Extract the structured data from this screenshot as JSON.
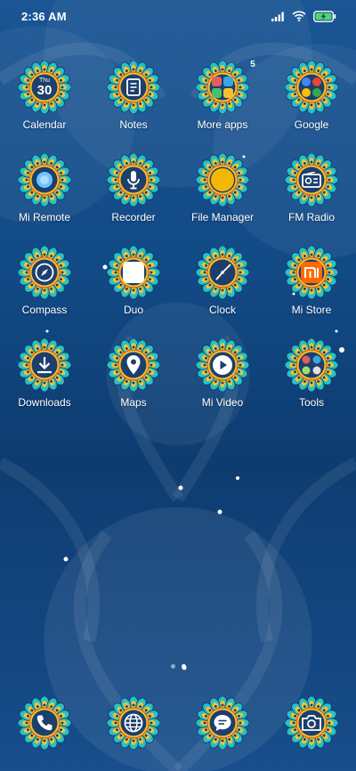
{
  "status_bar": {
    "time": "2:36 AM",
    "icons": [
      "signal-icon",
      "wifi-icon",
      "battery-charging-icon"
    ]
  },
  "colors": {
    "wallpaper": "#124a86",
    "mandala_outer": "#27c1c7",
    "mandala_ring": "#f2c230",
    "mandala_dark": "#1c3f6e"
  },
  "calendar": {
    "weekday": "Thu",
    "day": "30"
  },
  "apps": [
    {
      "label": "Calendar",
      "icon": "calendar-icon"
    },
    {
      "label": "Notes",
      "icon": "notes-icon"
    },
    {
      "label": "More apps",
      "icon": "folder-icon",
      "badge": "5"
    },
    {
      "label": "Google",
      "icon": "google-folder-icon"
    },
    {
      "label": "Mi Remote",
      "icon": "remote-icon"
    },
    {
      "label": "Recorder",
      "icon": "microphone-icon"
    },
    {
      "label": "File Manager",
      "icon": "file-manager-icon"
    },
    {
      "label": "FM Radio",
      "icon": "radio-icon"
    },
    {
      "label": "Compass",
      "icon": "compass-icon"
    },
    {
      "label": "Duo",
      "icon": "duo-icon"
    },
    {
      "label": "Clock",
      "icon": "clock-icon"
    },
    {
      "label": "Mi Store",
      "icon": "mi-store-icon"
    },
    {
      "label": "Downloads",
      "icon": "download-icon"
    },
    {
      "label": "Maps",
      "icon": "map-pin-icon"
    },
    {
      "label": "Mi Video",
      "icon": "play-icon"
    },
    {
      "label": "Tools",
      "icon": "tools-folder-icon"
    }
  ],
  "page_indicator": {
    "pages": 2,
    "current": 2
  },
  "dock": [
    {
      "icon": "phone-icon"
    },
    {
      "icon": "browser-icon"
    },
    {
      "icon": "messages-icon"
    },
    {
      "icon": "camera-icon"
    }
  ]
}
